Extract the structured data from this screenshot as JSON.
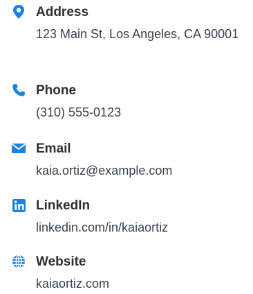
{
  "contact": {
    "icon_color": "#1a82e2",
    "items": [
      {
        "icon": "location-pin-icon",
        "label": "Address",
        "value": "123 Main St, Los Angeles, CA 90001"
      },
      {
        "icon": "phone-icon",
        "label": "Phone",
        "value": "(310) 555-0123"
      },
      {
        "icon": "envelope-icon",
        "label": "Email",
        "value": "kaia.ortiz@example.com"
      },
      {
        "icon": "linkedin-icon",
        "label": "LinkedIn",
        "value": "linkedin.com/in/kaiaortiz"
      },
      {
        "icon": "globe-icon",
        "label": "Website",
        "value": "kaiaortiz.com"
      }
    ]
  }
}
